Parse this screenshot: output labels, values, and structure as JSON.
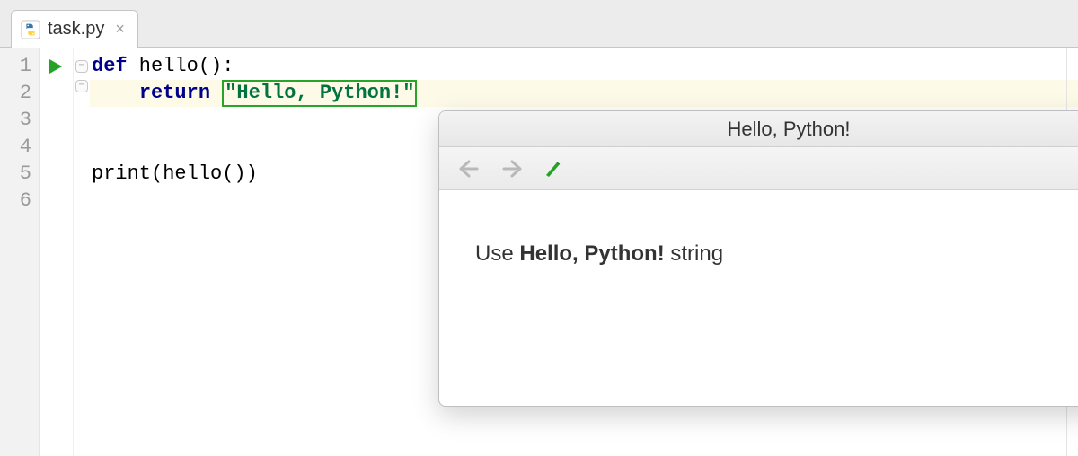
{
  "tab": {
    "filename": "task.py",
    "close_glyph": "×"
  },
  "gutter": {
    "lines": [
      "1",
      "2",
      "3",
      "4",
      "5",
      "6"
    ]
  },
  "code": {
    "line1_kw": "def",
    "line1_rest": " hello():",
    "line2_indent": "    ",
    "line2_kw": "return",
    "line2_space": " ",
    "line2_str": "\"Hello, Python!\"",
    "line5": "print(hello())"
  },
  "popup": {
    "title": "Hello, Python!",
    "body_prefix": "Use ",
    "body_bold": "Hello, Python!",
    "body_suffix": " string"
  }
}
